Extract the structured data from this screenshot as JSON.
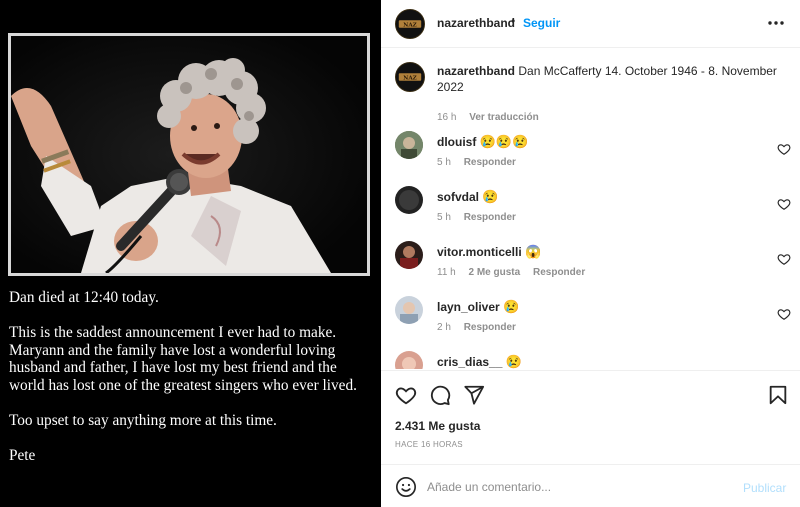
{
  "post": {
    "text_paragraphs": [
      "Dan died at 12:40 today.",
      "This is the saddest announcement I ever had to make. Maryann and the family have lost a wonderful loving husband and father, I have lost my best friend and the world has lost one of the greatest singers who ever lived.",
      "Too upset to say anything more at this time.",
      "Pete"
    ]
  },
  "header": {
    "username": "nazarethband",
    "dot": "•",
    "follow_label": "Seguir",
    "more_icon": "more-horizontal-icon"
  },
  "caption": {
    "username": "nazarethband",
    "text": "Dan McCafferty 14. October 1946 - 8. November 2022",
    "time": "16 h",
    "translate_label": "Ver traducción"
  },
  "comments": [
    {
      "username": "dlouisf",
      "emoji": "😢😢😢",
      "time": "5 h",
      "likes": "",
      "reply_label": "Responder"
    },
    {
      "username": "sofvdal",
      "emoji": "😢",
      "time": "5 h",
      "likes": "",
      "reply_label": "Responder"
    },
    {
      "username": "vitor.monticelli",
      "emoji": "😱",
      "time": "11 h",
      "likes": "2 Me gusta",
      "reply_label": "Responder"
    },
    {
      "username": "layn_oliver",
      "emoji": "😢",
      "time": "2 h",
      "likes": "",
      "reply_label": "Responder"
    },
    {
      "username": "cris_dias__",
      "emoji": "😢",
      "time": "",
      "likes": "",
      "reply_label": ""
    }
  ],
  "actions": {
    "likes_count": "2.431 Me gusta",
    "time_ago": "HACE 16 HORAS"
  },
  "add_comment": {
    "placeholder": "Añade un comentario...",
    "publish_label": "Publicar"
  },
  "colors": {
    "accent": "#0095f6",
    "publish_disabled": "#b2dffc",
    "muted_text": "#8e8e8e",
    "primary_text": "#262626",
    "divider": "#efefef"
  }
}
